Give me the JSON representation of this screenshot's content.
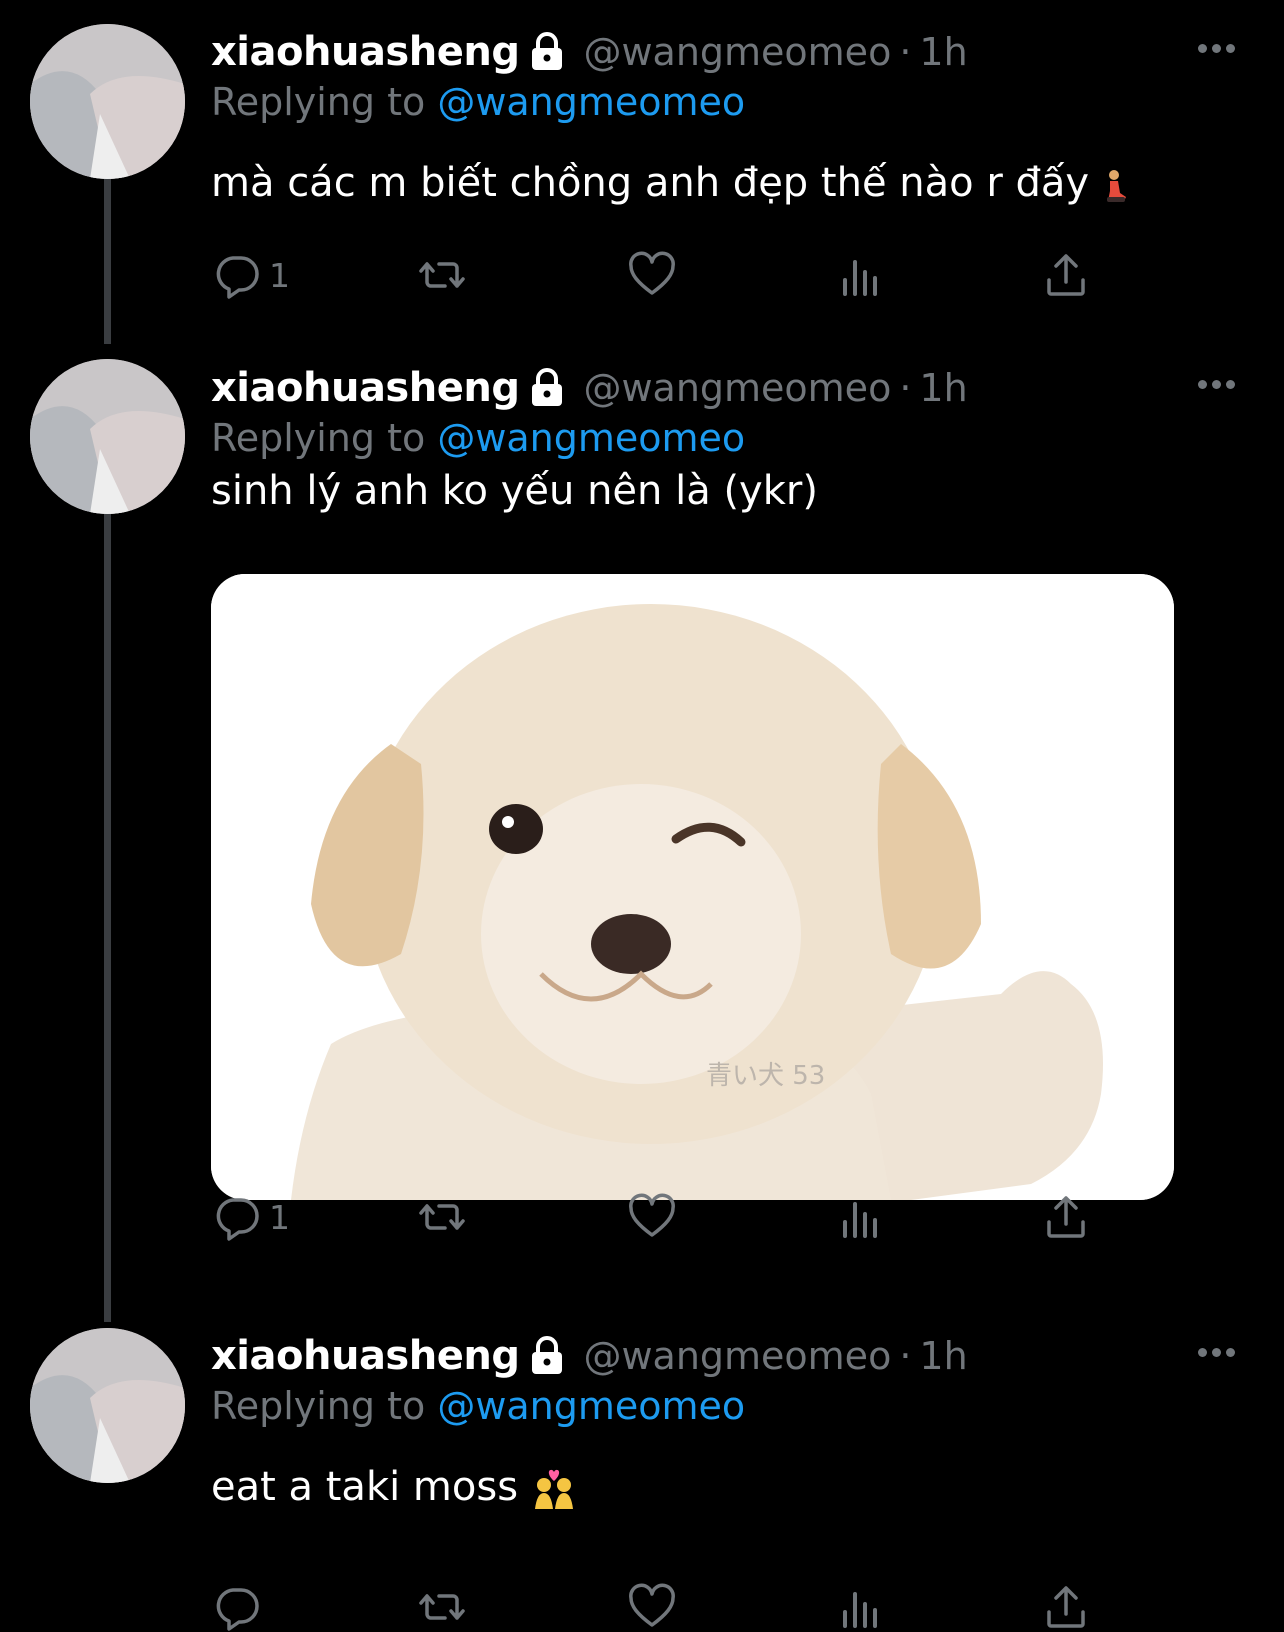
{
  "tweets": [
    {
      "display_name": "xiaohuasheng",
      "handle": "@wangmeomeo",
      "time": "1h",
      "replying_to_prefix": "Replying to ",
      "replying_to_handle": "@wangmeomeo",
      "text": "mà các m biết chồng anh đẹp thế nào r đấy",
      "reply_count": "1",
      "emoji": "person-kneeling-emoji"
    },
    {
      "display_name": "xiaohuasheng",
      "handle": "@wangmeomeo",
      "time": "1h",
      "replying_to_prefix": "Replying to ",
      "replying_to_handle": "@wangmeomeo",
      "text": "sinh lý anh ko yếu nên là (ykr)",
      "reply_count": "1",
      "media_watermark": "青い犬 53"
    },
    {
      "display_name": "xiaohuasheng",
      "handle": "@wangmeomeo",
      "time": "1h",
      "replying_to_prefix": "Replying to ",
      "replying_to_handle": "@wangmeomeo",
      "text": "eat a taki moss",
      "reply_count": "",
      "emoji": "people-with-heart-emoji"
    }
  ],
  "separator": "·",
  "icons": {
    "reply": "reply-icon",
    "retweet": "retweet-icon",
    "like": "heart-icon",
    "views": "views-icon",
    "share": "share-icon",
    "protected": "lock-icon",
    "more": "more-icon"
  },
  "colors": {
    "background": "#000000",
    "name": "#ffffff",
    "secondary": "#71767b",
    "mention": "#1d9bf0",
    "thread_line": "#3a3d41"
  }
}
